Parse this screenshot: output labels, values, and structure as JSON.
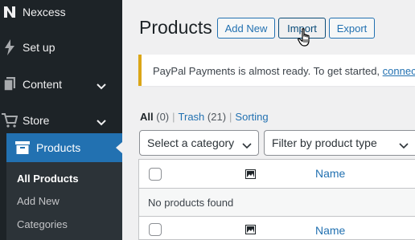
{
  "sidebar": {
    "items": [
      {
        "label": "Nexcess",
        "icon": "nexcess-logo-icon"
      },
      {
        "label": "Set up",
        "icon": "lightning-icon"
      },
      {
        "label": "Content",
        "icon": "pages-icon"
      },
      {
        "label": "Store",
        "icon": "cart-icon"
      },
      {
        "label": "Products",
        "icon": "archive-icon"
      }
    ],
    "submenu": [
      "All Products",
      "Add New",
      "Categories"
    ]
  },
  "header": {
    "title": "Products",
    "buttons": {
      "add_new": "Add New",
      "import": "Import",
      "export": "Export"
    }
  },
  "notice": {
    "text": "PayPal Payments is almost ready. To get started, ",
    "link": "connect"
  },
  "views": {
    "all_label": "All",
    "all_count": "(0)",
    "trash_label": "Trash",
    "trash_count": "(21)",
    "sorting_label": "Sorting",
    "separator": "|"
  },
  "filters": {
    "category": "Select a category",
    "product_type": "Filter by product type"
  },
  "table": {
    "header_name": "Name",
    "footer_name": "Name",
    "empty": "No products found"
  },
  "colors": {
    "sidebar_bg": "#1d2327",
    "accent": "#2271b1",
    "notice_border": "#dba617"
  }
}
